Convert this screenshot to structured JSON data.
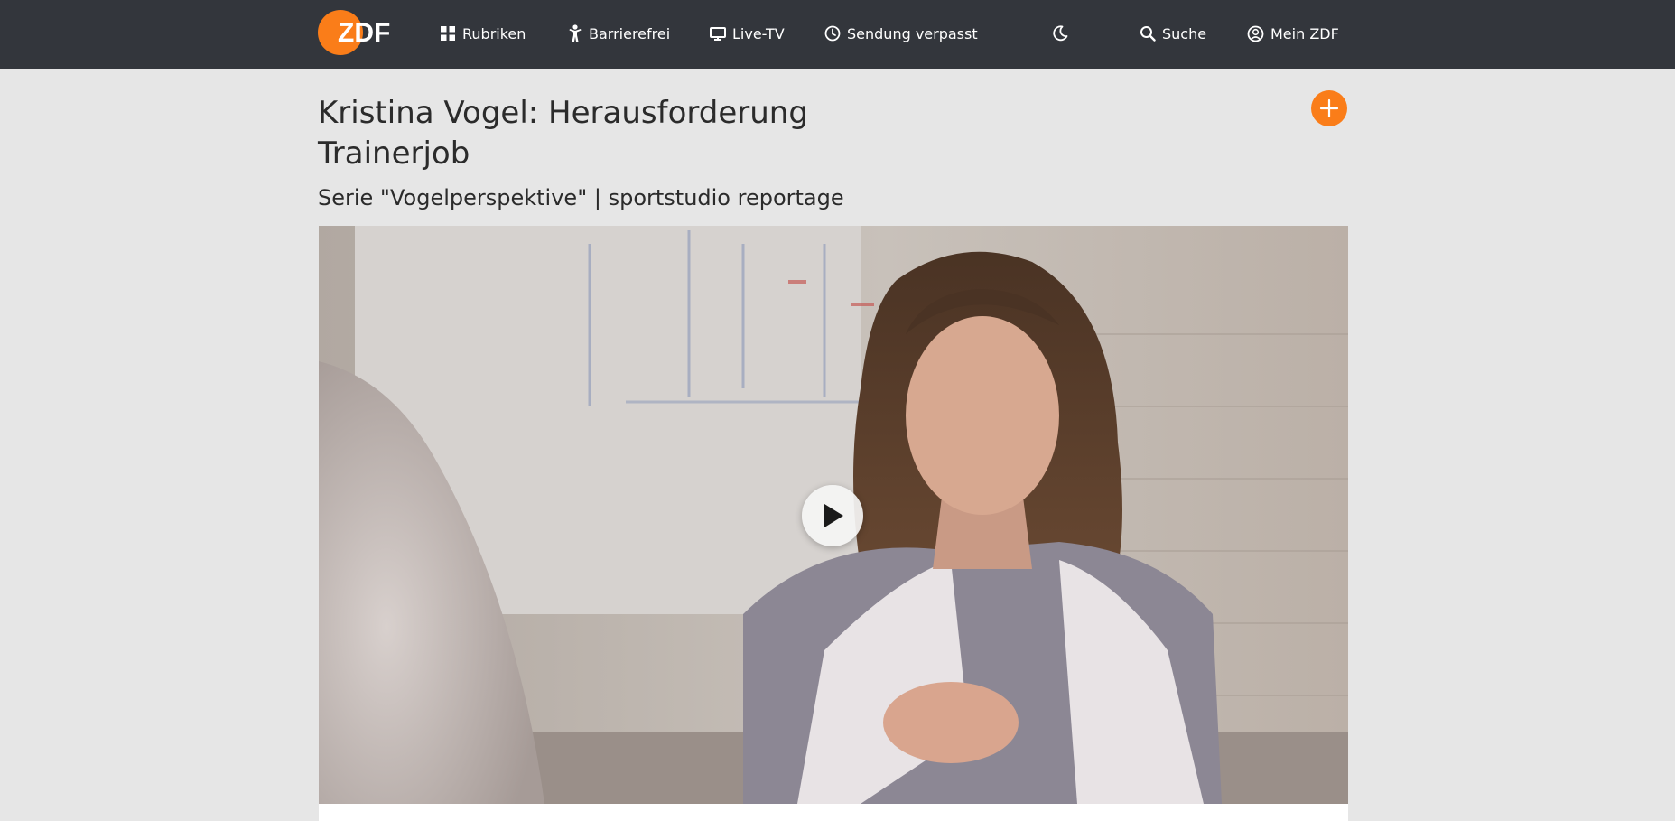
{
  "header": {
    "logo_text": "ZDF",
    "brand_color": "#fa7d19",
    "background_color": "#33363c",
    "nav": {
      "rubriken": {
        "label": "Rubriken",
        "icon": "grid-icon"
      },
      "barrierefrei": {
        "label": "Barrierefrei",
        "icon": "accessibility-icon"
      },
      "live_tv": {
        "label": "Live-TV",
        "icon": "tv-icon"
      },
      "sendung_verpasst": {
        "label": "Sendung verpasst",
        "icon": "clock-icon"
      },
      "theme_toggle": {
        "icon": "moon-icon"
      },
      "suche": {
        "label": "Suche",
        "icon": "search-icon"
      },
      "mein_zdf": {
        "label": "Mein ZDF",
        "icon": "user-circle-icon"
      }
    }
  },
  "main": {
    "title": "Kristina Vogel: Herausforderung Trainerjob",
    "subtitle": "Serie \"Vogelperspektive\" | sportstudio reportage",
    "add_button_icon": "plus-icon",
    "video": {
      "play_icon": "play-icon"
    }
  }
}
